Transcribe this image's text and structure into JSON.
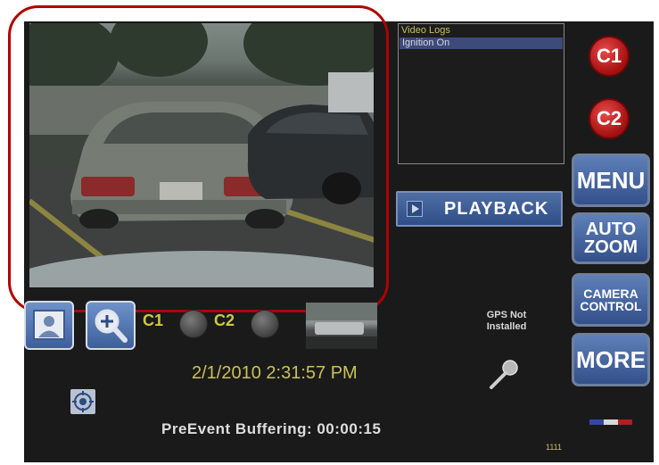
{
  "log_panel": {
    "title": "Video Logs",
    "selected_item": "Ignition On"
  },
  "buttons": {
    "playback": "PLAYBACK",
    "c1": "C1",
    "c2": "C2",
    "menu": "MENU",
    "auto_zoom_line1": "AUTO",
    "auto_zoom_line2": "ZOOM",
    "camera_control_line1": "CAMERA",
    "camera_control_line2": "CONTROL",
    "more": "MORE"
  },
  "camera_status": {
    "c1_label": "C1",
    "c2_label": "C2"
  },
  "gps": {
    "line1": "GPS Not",
    "line2": "Installed"
  },
  "datetime": "2/1/2010 2:31:57 PM",
  "buffering": "PreEvent Buffering: 00:00:15",
  "counter": "1111",
  "colors": {
    "highlight_frame": "#b00000",
    "accent_text": "#c9c15a",
    "button_blue": "#33508a",
    "record_red": "#a40f0f"
  },
  "icons": {
    "playback": "play-icon",
    "snapshot": "person-photo-icon",
    "zoom": "magnifier-plus-icon",
    "target": "crosshair-target-icon",
    "microphone": "microphone-icon",
    "flag": "flag-bar-icon"
  }
}
